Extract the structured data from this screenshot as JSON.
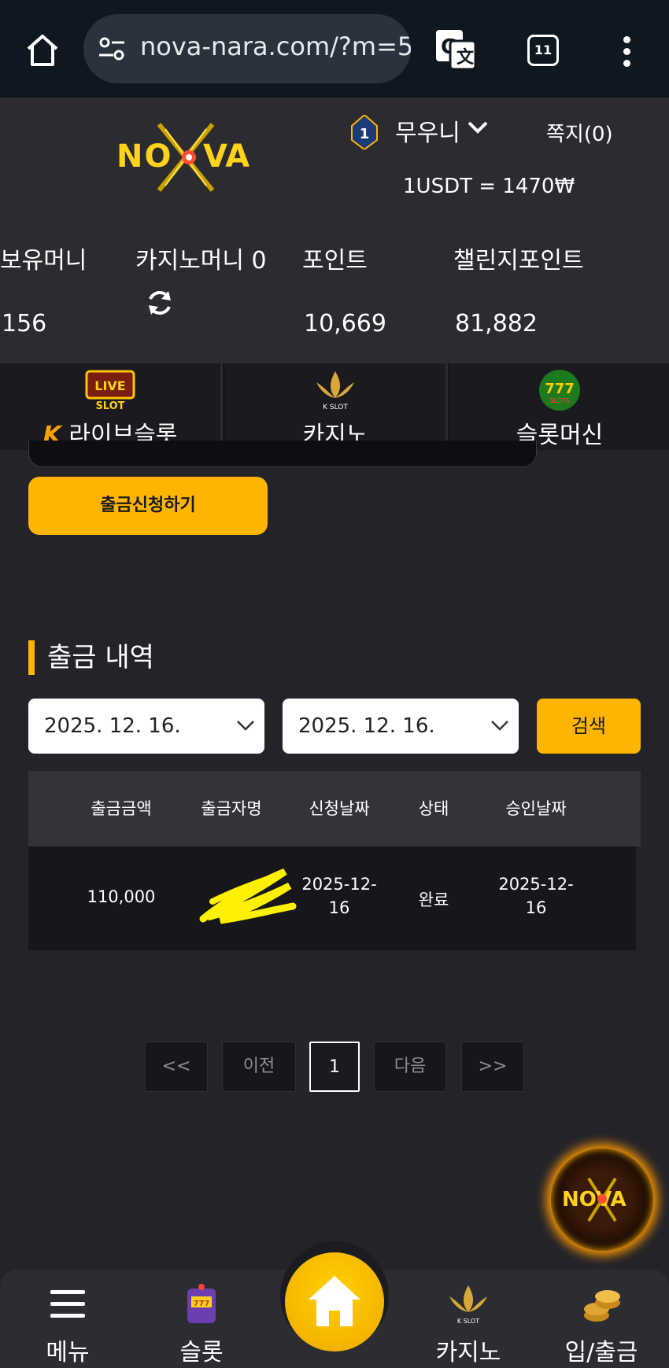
{
  "browser": {
    "url": "nova-nara.com/?m=5",
    "tab_count": "11"
  },
  "header": {
    "logo_text": "NOVA",
    "level": "1",
    "username": "무우니",
    "messages": "쪽지(0)",
    "rate": "1USDT = 1470₩"
  },
  "stats": {
    "holding_label": "보유머니",
    "holding_value": "156",
    "casino_label": "카지노머니 0",
    "point_label": "포인트",
    "point_value": "10,669",
    "challenge_label": "챌린지포인트",
    "challenge_value": "81,882"
  },
  "game_tabs": [
    {
      "label": "라이브슬롯",
      "icon": "live-slot-icon"
    },
    {
      "label": "카지노",
      "icon": "k-slot-icon"
    },
    {
      "label": "슬롯머신",
      "icon": "777-slots-icon"
    }
  ],
  "withdraw_button": "출금신청하기",
  "history": {
    "title": "출금 내역",
    "date_from": "2025. 12. 16.",
    "date_to": "2025. 12. 16.",
    "search_label": "검색",
    "columns": [
      "출금금액",
      "출금자명",
      "신청날짜",
      "상태",
      "승인날짜"
    ],
    "rows": [
      {
        "amount": "110,000",
        "name": "김",
        "request_date_1": "2025-12-",
        "request_date_2": "16",
        "status": "완료",
        "approve_date_1": "2025-12-",
        "approve_date_2": "16"
      }
    ]
  },
  "pagination": {
    "first": "<<",
    "prev": "이전",
    "current": "1",
    "next": "다음",
    "last": ">>"
  },
  "bottom_nav": {
    "menu": "메뉴",
    "slot": "슬롯",
    "casino": "카지노",
    "deposit": "입/출금"
  },
  "colors": {
    "accent": "#ffb400",
    "background": "#232329",
    "header": "#2b2b30"
  }
}
